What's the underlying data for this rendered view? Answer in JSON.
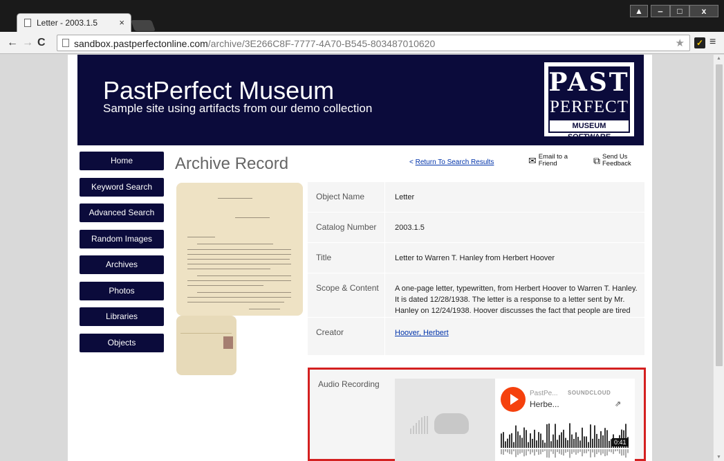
{
  "browser": {
    "tab_title": "Letter - 2003.1.5",
    "tab_close": "×",
    "url_host": "sandbox.pastperfectonline.com",
    "url_path": "/archive/3E266C8F-7777-4A70-B545-803487010620",
    "nav_back": "←",
    "nav_forward": "→",
    "nav_reload": "C",
    "star": "★",
    "extension_icon": "✓",
    "menu": "≡",
    "window_controls": {
      "user": "▲",
      "minimize": "‒",
      "maximize": "□",
      "close": "x"
    }
  },
  "banner": {
    "title": "PastPerfect Museum",
    "subtitle": "Sample site using artifacts from our demo collection",
    "logo": {
      "line1": "PAST",
      "line2": "PERFECT",
      "line3": "MUSEUM SOFTWARE"
    }
  },
  "sidebar": {
    "items": [
      {
        "label": "Home"
      },
      {
        "label": "Keyword Search"
      },
      {
        "label": "Advanced Search"
      },
      {
        "label": "Random Images"
      },
      {
        "label": "Archives"
      },
      {
        "label": "Photos"
      },
      {
        "label": "Libraries"
      },
      {
        "label": "Objects"
      }
    ]
  },
  "main": {
    "heading": "Archive Record",
    "return_link": "Return To Search Results",
    "return_prefix": "<",
    "email_friend": "Email to a Friend",
    "send_feedback": "Send Us Feedback",
    "record": [
      {
        "label": "Object Name",
        "value": "Letter"
      },
      {
        "label": "Catalog Number",
        "value": "2003.1.5"
      },
      {
        "label": "Title",
        "value": "Letter to Warren T. Hanley from Herbert Hoover"
      },
      {
        "label": "Scope & Content",
        "value": "A one-page letter, typewritten, from Herbert Hoover to Warren T. Hanley. It is dated 12/28/1938. The letter is a response to a letter sent by Mr. Hanley on 12/24/1938. Hoover discusses the fact that people are tired of politics after an election."
      },
      {
        "label": "Creator",
        "value": "Hoover, Herbert"
      }
    ],
    "audio": {
      "label": "Audio Recording",
      "user": "PastPe...",
      "brand": "SOUNDCLOUD",
      "track": "Herbe...",
      "time": "0:41",
      "share_icon": "⇗"
    }
  },
  "colors": {
    "banner_bg": "#0b0b3b",
    "nav_bg": "#0b0b3b",
    "highlight_border": "#d42020",
    "soundcloud_orange": "#f5410d",
    "link": "#0033aa"
  }
}
